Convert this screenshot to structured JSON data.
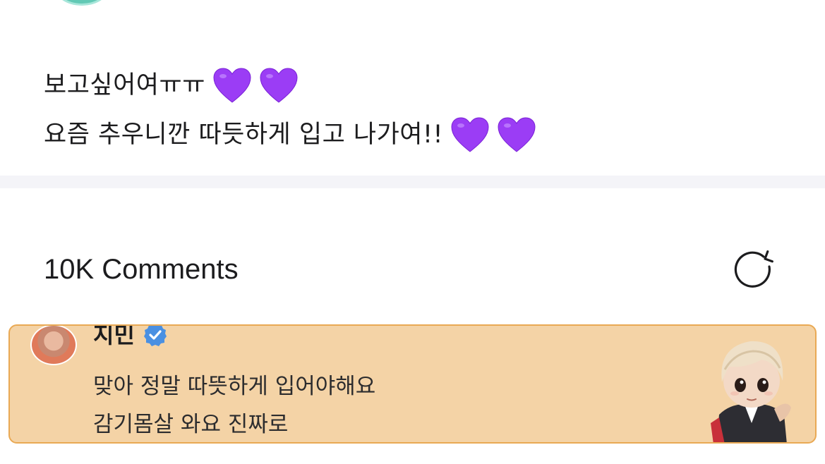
{
  "post": {
    "lines": [
      {
        "text": "보고싶어여ㅠㅠ",
        "hearts": 2
      },
      {
        "text": "요즘 추우니깐 따듯하게 입고 나가여!!",
        "hearts": 2
      }
    ],
    "heart_emoji": "purple-heart",
    "heart_color": "#9b3df5"
  },
  "comments": {
    "header": "10K Comments",
    "refresh_icon": "refresh-icon"
  },
  "highlighted_comment": {
    "author": "지민",
    "verified": true,
    "verified_color": "#4a90e2",
    "lines": [
      "맞아 정말 따뜻하게 입어야해요",
      "감기몸살 와요 진짜로"
    ],
    "background_color": "#f4d3a6",
    "border_color": "#e9a954"
  }
}
